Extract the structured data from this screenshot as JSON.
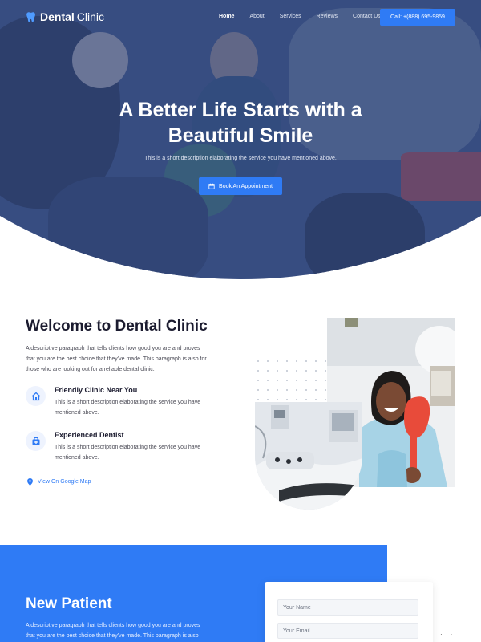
{
  "brand": {
    "name_bold": "Dental",
    "name_rest": "Clinic"
  },
  "nav": {
    "items": [
      "Home",
      "About",
      "Services",
      "Reviews",
      "Contact Us"
    ],
    "active": "Home",
    "call_label": "Call: +(888) 695-9859"
  },
  "hero": {
    "title_line1": "A Better Life Starts with a",
    "title_line2": "Beautiful Smile",
    "description": "This is a short description elaborating the service you have mentioned above.",
    "cta_label": "Book An Appointment"
  },
  "welcome": {
    "title": "Welcome to Dental Clinic",
    "paragraph_lines": [
      "A descriptive paragraph that tells clients how good you are and proves",
      "that you are the best choice that they've made. This paragraph is also for",
      "those who are looking out for a reliable dental clinic."
    ],
    "features": [
      {
        "title": "Friendly Clinic Near You",
        "icon": "home-icon",
        "desc_lines": [
          "This is a short description elaborating the service you have",
          "mentioned above."
        ]
      },
      {
        "title": "Experienced Dentist",
        "icon": "medical-bag-icon",
        "desc_lines": [
          "This is a short description elaborating the service you have",
          "mentioned above."
        ]
      }
    ],
    "map_link": "View On Google Map"
  },
  "new_patient": {
    "title": "New Patient",
    "paragraph_lines": [
      "A descriptive paragraph that tells clients how good you are and proves",
      "that you are the best choice that they've made. This paragraph is also"
    ],
    "form": {
      "name_placeholder": "Your Name",
      "email_placeholder": "Your Email"
    }
  },
  "colors": {
    "accent": "#2f7bf5",
    "hero_overlay": "#3d5282",
    "heading": "#1b1b2f"
  }
}
